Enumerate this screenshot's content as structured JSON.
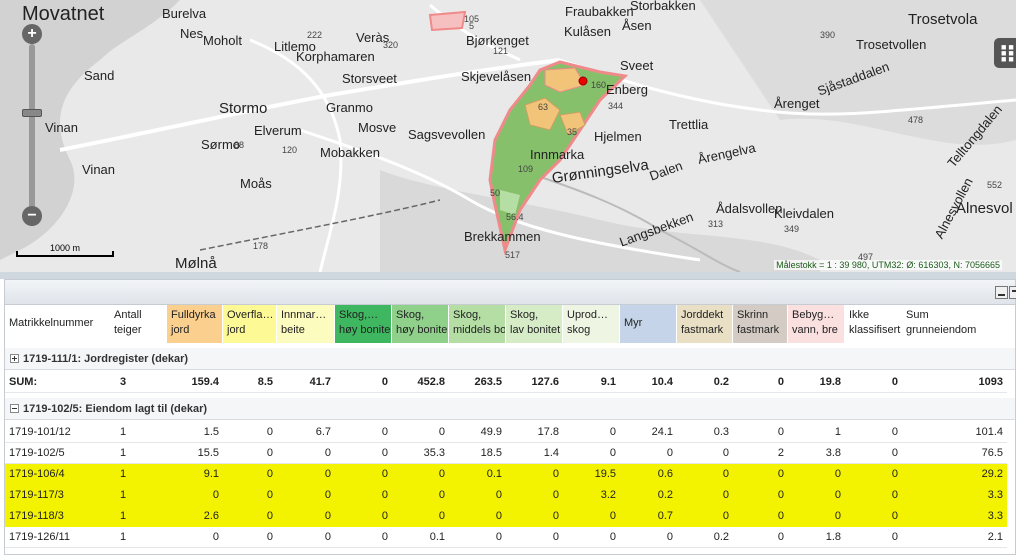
{
  "map": {
    "title": "Movatnet",
    "zoom_in": "+",
    "zoom_out": "−",
    "scale_label": "1000 m",
    "scale_info": "Målestokk = 1 : 39 980, UTM32: Ø: 616303, N: 7056665",
    "places": [
      {
        "text": "Burelva",
        "size": "med"
      },
      {
        "text": "Nes",
        "size": "med"
      },
      {
        "text": "Moholt",
        "size": "med"
      },
      {
        "text": "Litlemo",
        "size": "med"
      },
      {
        "text": "Korphamaren",
        "size": "med"
      },
      {
        "text": "Veràs",
        "size": "med"
      },
      {
        "text": "Sand",
        "size": "med"
      },
      {
        "text": "Storsveet",
        "size": "med"
      },
      {
        "text": "Skjevelåsen",
        "size": "med"
      },
      {
        "text": "Bjørkenget",
        "size": "med"
      },
      {
        "text": "Fraubakken",
        "size": "med"
      },
      {
        "text": "Storbakken",
        "size": "med"
      },
      {
        "text": "Kulåsen",
        "size": "med"
      },
      {
        "text": "Åsen",
        "size": "med"
      },
      {
        "text": "Svеet",
        "size": "med"
      },
      {
        "text": "Trosetvola",
        "size": "big"
      },
      {
        "text": "Trosetvollen",
        "size": "med"
      },
      {
        "text": "Stormo",
        "size": "big"
      },
      {
        "text": "Granmo",
        "size": "med"
      },
      {
        "text": "Vinan",
        "size": "med"
      },
      {
        "text": "Elverum",
        "size": "med"
      },
      {
        "text": "Mosve",
        "size": "med"
      },
      {
        "text": "Sagsvevollen",
        "size": "med"
      },
      {
        "text": "Hjelmen",
        "size": "med"
      },
      {
        "text": "Trettlia",
        "size": "med"
      },
      {
        "text": "Årenget",
        "size": "med"
      },
      {
        "text": "Sjåstaddalen",
        "size": "med"
      },
      {
        "text": "Sørmo",
        "size": "med"
      },
      {
        "text": "Mobakken",
        "size": "med"
      },
      {
        "text": "Vinan",
        "size": "med"
      },
      {
        "text": "Moås",
        "size": "med"
      },
      {
        "text": "Grønningselva",
        "size": "big"
      },
      {
        "text": "Dalen",
        "size": "med"
      },
      {
        "text": "Årengelva",
        "size": "med"
      },
      {
        "text": "Telltongdalen",
        "size": "med"
      },
      {
        "text": "Ådalsvollen",
        "size": "med"
      },
      {
        "text": "Alnesvol",
        "size": "big"
      },
      {
        "text": "Brekkammen",
        "size": "med"
      },
      {
        "text": "Kleivdalen",
        "size": "med"
      },
      {
        "text": "Alnesvollen",
        "size": "med"
      },
      {
        "text": "Mølnå",
        "size": "big"
      },
      {
        "text": "Enberg",
        "size": "med"
      },
      {
        "text": "Innmarka",
        "size": "med"
      },
      {
        "text": "Langsbekken",
        "size": "med"
      }
    ],
    "numbers": [
      "222",
      "121",
      "320",
      "390",
      "344",
      "478",
      "120",
      "88",
      "178",
      "313",
      "349",
      "552",
      "517",
      "497",
      "105",
      "160",
      "63",
      "35",
      "109",
      "50",
      "56.4",
      "5"
    ],
    "colors": {
      "parcel_outline": "#f08a8a",
      "forest": "#86c06b",
      "cultivated": "#f2c47a",
      "road": "#ffffff"
    }
  },
  "table": {
    "columns": [
      {
        "label": "Matrikkelnummer",
        "bg": "#ffffff"
      },
      {
        "label": "Antall\nteiger",
        "bg": "#ffffff"
      },
      {
        "label": "Fulldyrka\njord",
        "bg": "#fbcf8e"
      },
      {
        "label": "Overfla…\njord",
        "bg": "#fdfa95"
      },
      {
        "label": "Innmar…\nbeite",
        "bg": "#fdfcbf"
      },
      {
        "label": "Skog,…\nhøy bonite",
        "bg": "#3fb660"
      },
      {
        "label": "Skog,\nhøy bonite",
        "bg": "#8fd08b"
      },
      {
        "label": "Skog,\nmiddels bo",
        "bg": "#b5dea5"
      },
      {
        "label": "Skog,\nlav bonitet",
        "bg": "#d6ecc7"
      },
      {
        "label": "Uprod…\nskog",
        "bg": "#eef5e2"
      },
      {
        "label": "Myr",
        "bg": "#c5d4e9"
      },
      {
        "label": "Jorddekt\nfastmark",
        "bg": "#e8dfc4"
      },
      {
        "label": "Skrinn\nfastmark",
        "bg": "#d4ccc4"
      },
      {
        "label": "Bebyg…\nvann, bre",
        "bg": "#fbe0e0"
      },
      {
        "label": "Ikke\nklassifisert",
        "bg": "#ffffff"
      },
      {
        "label": "Sum\ngrunneiendom",
        "bg": "#ffffff"
      }
    ],
    "group1": {
      "label": "1719-111/1: Jordregister (dekar)",
      "expanded": false
    },
    "sum_row": [
      "SUM:",
      "3",
      "159.4",
      "8.5",
      "41.7",
      "0",
      "452.8",
      "263.5",
      "127.6",
      "9.1",
      "10.4",
      "0.2",
      "0",
      "19.8",
      "0",
      "1093"
    ],
    "group2": {
      "label": "1719-102/5: Eiendom lagt til (dekar)",
      "expanded": true
    },
    "rows": [
      [
        "1719-101/12",
        "1",
        "1.5",
        "0",
        "6.7",
        "0",
        "0",
        "49.9",
        "17.8",
        "0",
        "24.1",
        "0.3",
        "0",
        "1",
        "0",
        "101.4"
      ],
      [
        "1719-102/5",
        "1",
        "15.5",
        "0",
        "0",
        "0",
        "35.3",
        "18.5",
        "1.4",
        "0",
        "0",
        "0",
        "2",
        "3.8",
        "0",
        "76.5"
      ],
      [
        "1719-106/4",
        "1",
        "9.1",
        "0",
        "0",
        "0",
        "0",
        "0.1",
        "0",
        "19.5",
        "0.6",
        "0",
        "0",
        "0",
        "0",
        "29.2"
      ],
      [
        "1719-117/3",
        "1",
        "0",
        "0",
        "0",
        "0",
        "0",
        "0",
        "0",
        "3.2",
        "0.2",
        "0",
        "0",
        "0",
        "0",
        "3.3"
      ],
      [
        "1719-118/3",
        "1",
        "2.6",
        "0",
        "0",
        "0",
        "0",
        "0",
        "0",
        "0",
        "0.7",
        "0",
        "0",
        "0",
        "0",
        "3.3"
      ],
      [
        "1719-126/11",
        "1",
        "0",
        "0",
        "0",
        "0",
        "0.1",
        "0",
        "0",
        "0",
        "0",
        "0.2",
        "0",
        "1.8",
        "0",
        "2.1"
      ]
    ],
    "highlight_color": "#f3f300"
  }
}
